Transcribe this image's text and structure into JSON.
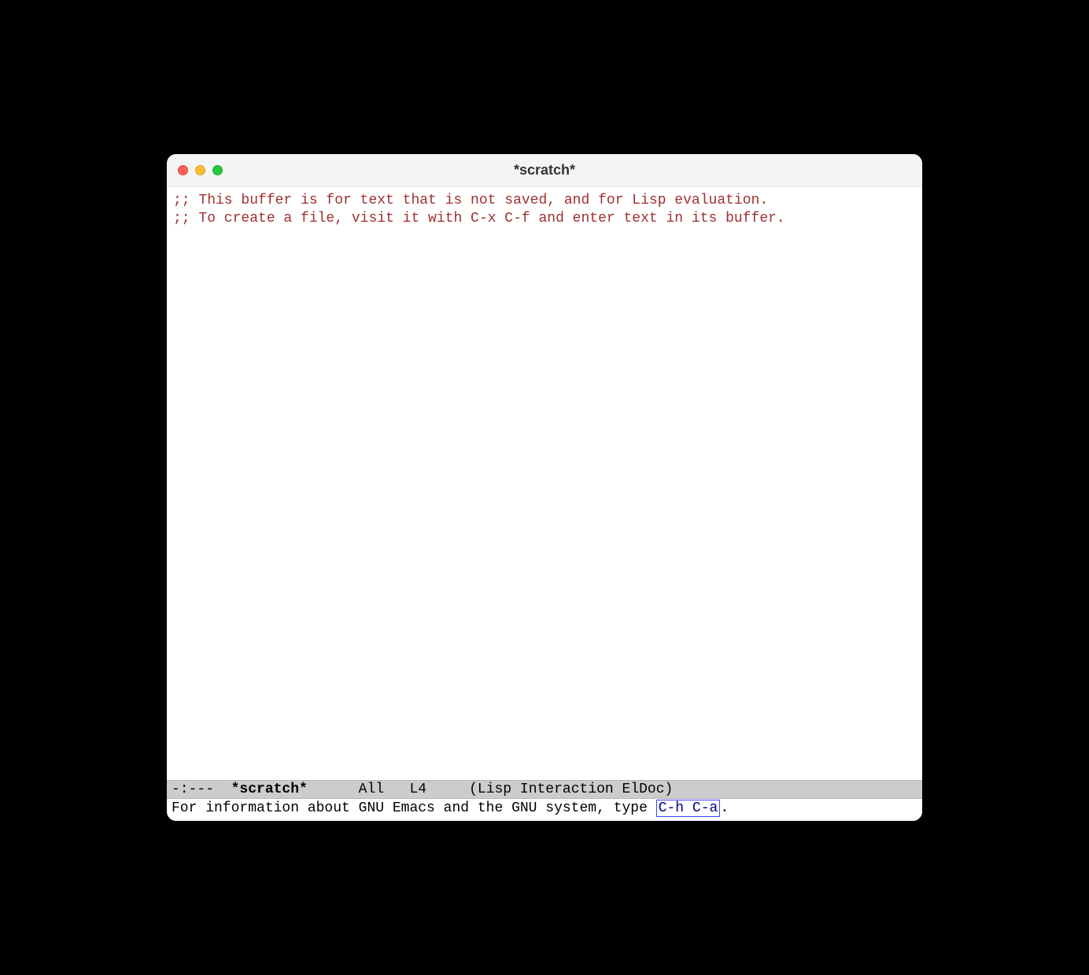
{
  "window": {
    "title": "*scratch*"
  },
  "buffer": {
    "lines": [
      ";; This buffer is for text that is not saved, and for Lisp evaluation.",
      ";; To create a file, visit it with C-x C-f and enter text in its buffer."
    ]
  },
  "modeline": {
    "status": "-:--- ",
    "buffer_name": "*scratch*",
    "position": "All",
    "line": "L4",
    "modes": "(Lisp Interaction ElDoc)"
  },
  "minibuffer": {
    "prefix": "For information about GNU Emacs and the GNU system, type ",
    "key": "C-h C-a",
    "suffix": "."
  }
}
